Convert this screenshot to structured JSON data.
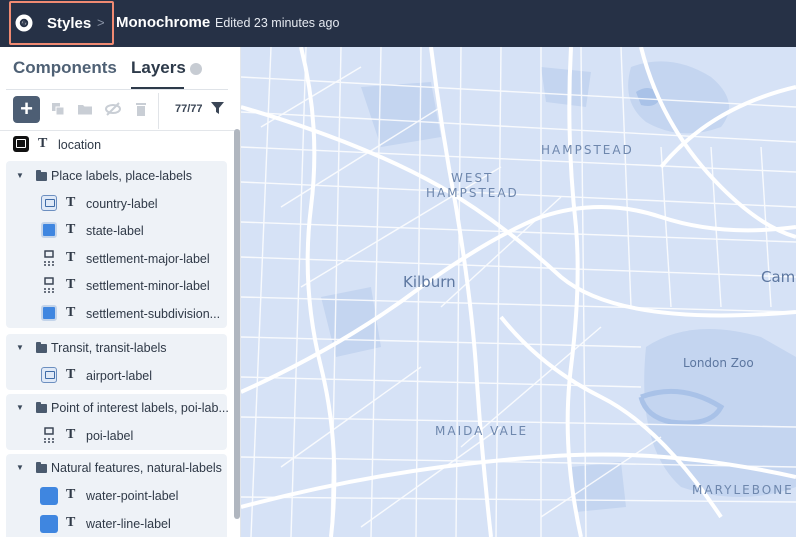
{
  "header": {
    "breadcrumb_root": "Styles",
    "chevron": ">",
    "style_name": "Monochrome",
    "edited_text": "Edited 23 minutes ago"
  },
  "sidebar": {
    "tabs": [
      {
        "label": "Components",
        "active": false
      },
      {
        "label": "Layers",
        "active": true
      }
    ],
    "toolbar": {
      "add_label": "+",
      "layer_count": "77/77"
    },
    "layers": [
      {
        "type": "layer",
        "label": "location",
        "icon": "image-black"
      },
      {
        "type": "group",
        "label": "Place labels, place-labels",
        "children": [
          {
            "label": "country-label",
            "icon": "image"
          },
          {
            "label": "state-label",
            "icon": "blue"
          },
          {
            "label": "settlement-major-label",
            "icon": "dots-image"
          },
          {
            "label": "settlement-minor-label",
            "icon": "dots-image"
          },
          {
            "label": "settlement-subdivision...",
            "icon": "blue"
          }
        ]
      },
      {
        "type": "group",
        "label": "Transit, transit-labels",
        "children": [
          {
            "label": "airport-label",
            "icon": "image"
          }
        ]
      },
      {
        "type": "group",
        "label": "Point of interest labels, poi-lab...",
        "children": [
          {
            "label": "poi-label",
            "icon": "dots-image"
          }
        ]
      },
      {
        "type": "group",
        "label": "Natural features, natural-labels",
        "children": [
          {
            "label": "water-point-label",
            "icon": "blue-solid"
          },
          {
            "label": "water-line-label",
            "icon": "blue-solid"
          }
        ]
      }
    ]
  },
  "map": {
    "labels": {
      "hampstead": "HAMPSTEAD",
      "west_hampstead_1": "WEST",
      "west_hampstead_2": "HAMPSTEAD",
      "kilburn": "Kilburn",
      "camden": "Cam",
      "london_zoo": "London Zoo",
      "maida_vale": "MAIDA VALE",
      "marylebone": "MARYLEBONE"
    },
    "colors": {
      "land": "#d6e2f6",
      "road": "#ffffff",
      "park": "#c4d5f0",
      "water": "#a9c2e8"
    }
  }
}
